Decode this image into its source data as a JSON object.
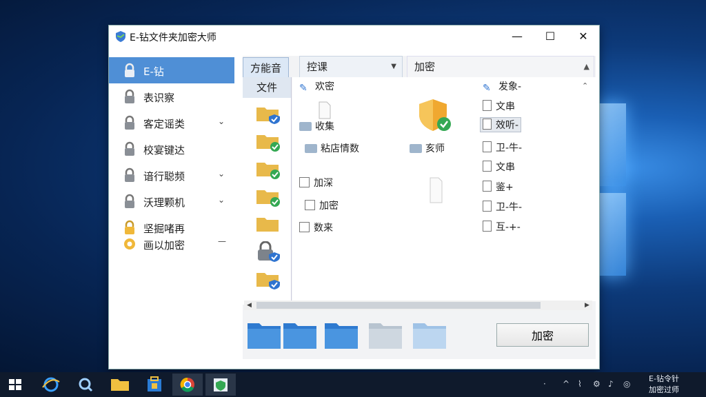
{
  "window": {
    "title": "E-钻文件夹加密大师",
    "min": "—",
    "max": "☐",
    "close": "✕"
  },
  "sidebar": {
    "items": [
      {
        "label": "E-钻",
        "chev": ""
      },
      {
        "label": "表识察",
        "chev": ""
      },
      {
        "label": "客定谣类",
        "chev": "⌄"
      },
      {
        "label": "校宴键达",
        "chev": ""
      },
      {
        "label": "谙行聪频",
        "chev": "⌄"
      },
      {
        "label": "沃理颗机",
        "chev": "⌄"
      },
      {
        "label": "坚掘啫再",
        "chev": ""
      },
      {
        "label": "画以加密",
        "chev": "—"
      }
    ]
  },
  "tabs": {
    "active": "方能音",
    "select": "控课",
    "select_caret": "▼",
    "encrypt": "加密",
    "up": "▲"
  },
  "left_column": {
    "header": "文件"
  },
  "content": {
    "scroll_up": "⌃",
    "left_entries": [
      {
        "label": "欢密"
      },
      {
        "label": "收集"
      },
      {
        "label": "粘店情数"
      },
      {
        "label": "加深"
      },
      {
        "label": "加密"
      },
      {
        "label": "数来"
      }
    ],
    "mid_entries": [
      {
        "label": "亥师"
      }
    ],
    "right_entries": [
      {
        "label": "发象-"
      },
      {
        "label": "文串"
      },
      {
        "label": "效听-"
      },
      {
        "label": "卫-牛-"
      },
      {
        "label": "文串"
      },
      {
        "label": "鉴+"
      },
      {
        "label": "卫-牛-"
      },
      {
        "label": "互-+-"
      }
    ]
  },
  "hscroll": {
    "left": "◀",
    "right": "▶"
  },
  "actions": {
    "encrypt_button": "加密"
  },
  "taskbar": {
    "tray_up": "^",
    "clock_line1": "E-钻令针",
    "clock_line2": "加密过师"
  }
}
